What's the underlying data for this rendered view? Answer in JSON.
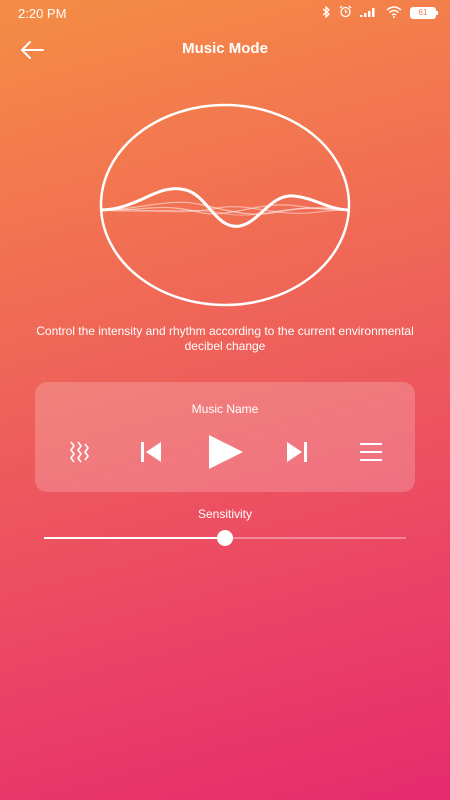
{
  "status_bar": {
    "time": "2:20 PM",
    "signal_text": "...ll",
    "battery": "61"
  },
  "header": {
    "title": "Music Mode"
  },
  "visualizer": {
    "description": "Control the intensity and rhythm according to the current environmental decibel change"
  },
  "player": {
    "track_name": "Music Name",
    "controls": [
      "mode-icon",
      "previous-icon",
      "play-icon",
      "next-icon",
      "playlist-icon"
    ]
  },
  "sensitivity": {
    "label": "Sensitivity",
    "value": 0.5
  },
  "colors": {
    "gradient_top": "#f58d45",
    "gradient_bottom": "#e62a6e",
    "foreground": "#ffffff"
  }
}
